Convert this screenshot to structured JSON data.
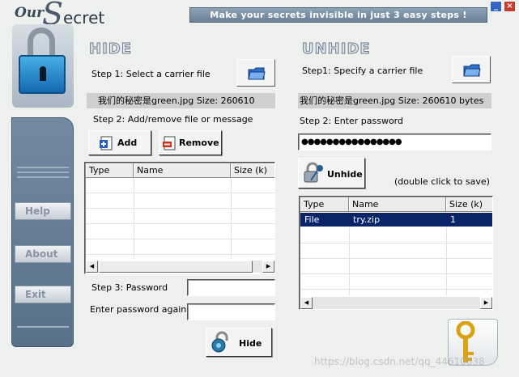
{
  "app": {
    "logo_our": "Our",
    "logo_s": "S",
    "logo_ecret": "ecret",
    "tagline": "Make your secrets invisible in just 3 easy steps !"
  },
  "sidebar": {
    "help_label": "Help",
    "about_label": "About",
    "exit_label": "Exit"
  },
  "hide": {
    "title": "HIDE",
    "step1_label": "Step 1: Select a carrier file",
    "file_info": "我们的秘密是green.jpg   Size: 260610",
    "step2_label": "Step 2: Add/remove file or message",
    "add_label": "Add",
    "remove_label": "Remove",
    "columns": [
      "Type",
      "Name",
      "Size (k)"
    ],
    "step3_label": "Step 3: Password",
    "password_again_label": "Enter password again",
    "password_value": "",
    "password_again_value": "",
    "hide_button_label": "Hide"
  },
  "unhide": {
    "title": "UNHIDE",
    "step1_label": "Step1: Specify a carrier file",
    "file_info": "我们的秘密是green.jpg   Size: 260610 bytes",
    "step2_label": "Step 2: Enter password",
    "password_value": "●●●●●●●●●●●●●●●●",
    "unhide_button_label": "Unhide",
    "hint": "(double click to save)",
    "columns": [
      "Type",
      "Name",
      "Size (k)"
    ],
    "rows": [
      {
        "type": "File",
        "name": "try.zip",
        "size": "1"
      }
    ]
  },
  "watermark": "https://blog.csdn.net/qq_44610838",
  "colors": {
    "banner": "#6a8096",
    "selection": "#0a246a",
    "sidebar": "#5e768f"
  }
}
